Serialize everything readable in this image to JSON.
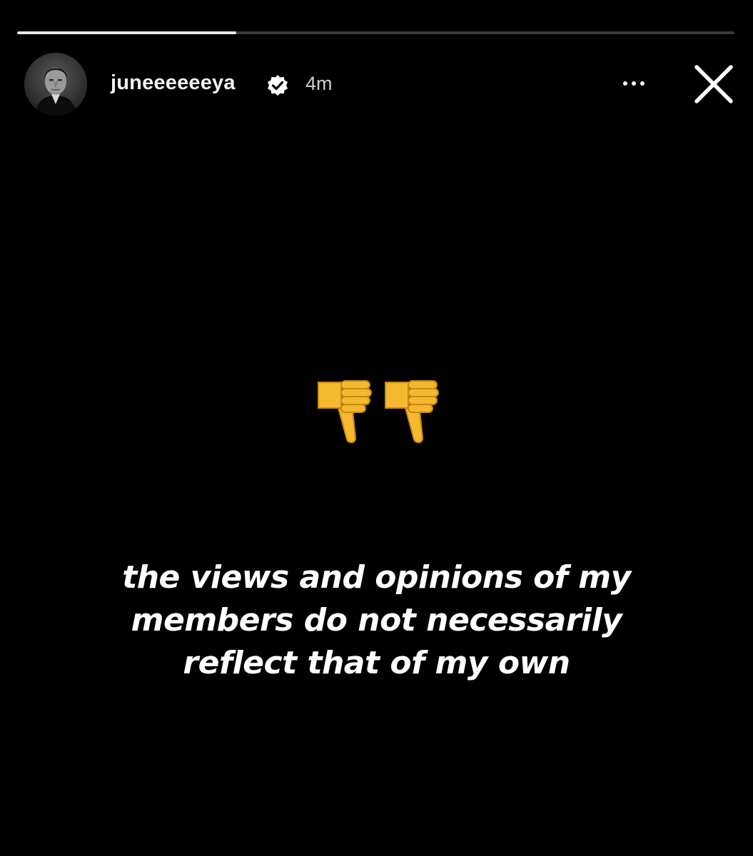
{
  "story": {
    "progress_fraction": 0.305,
    "account": {
      "username": "juneeeeeeya",
      "verified": true,
      "posted_ago": "4m",
      "avatar_icon": "profile-photo"
    },
    "controls": {
      "more_icon": "more-dots-icon",
      "close_icon": "close-icon"
    },
    "content": {
      "emojis": [
        "👎",
        "👎"
      ],
      "emoji_color": "#F5B82E",
      "caption_lines": [
        "the views and opinions of my",
        "members do not necessarily",
        "reflect that of my own"
      ]
    },
    "colors": {
      "background": "#000000",
      "text": "#FFFFFF",
      "progress_track": "#3A3A3A",
      "progress_fill": "#E6E6E6"
    }
  }
}
